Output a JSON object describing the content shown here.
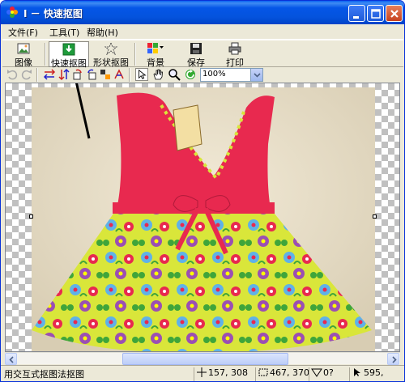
{
  "window": {
    "title": "I － 快速抠图"
  },
  "menu": [
    {
      "label": "文件(F)"
    },
    {
      "label": "工具(T)"
    },
    {
      "label": "帮助(H)"
    }
  ],
  "toolbar": {
    "image_label": "图像",
    "quick_cutout_label": "快速抠图",
    "shape_cutout_label": "形状抠图",
    "background_label": "背景",
    "save_label": "保存",
    "print_label": "打印"
  },
  "zoom": {
    "value": "100%"
  },
  "status": {
    "mode_text": "用交互式抠图法抠图",
    "cursor_pos": "157, 308",
    "image_size": "467, 370",
    "angle": "0?",
    "extra": "595,"
  },
  "colors": {
    "title_bar": "#0453dd",
    "window_bg": "#ece9d8",
    "dress_red": "#e8294f"
  },
  "icons": {
    "app": "flower-app-icon",
    "undo": "undo-icon",
    "redo": "redo-icon",
    "select": "arrow-pointer-icon",
    "hand": "hand-icon",
    "zoom": "magnifier-icon",
    "refresh": "refresh-icon"
  }
}
